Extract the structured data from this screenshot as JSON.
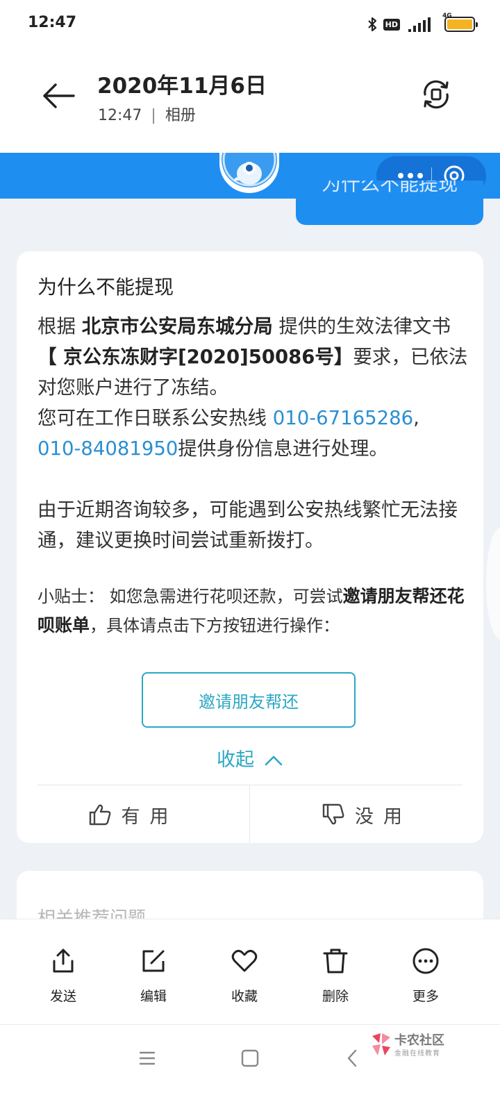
{
  "status_bar": {
    "time": "12:47",
    "hd_label": "HD",
    "network_label": "4G",
    "colors": {
      "battery": "#f5b324"
    },
    "icons": [
      "bluetooth-icon",
      "hd-icon",
      "signal-icon",
      "battery-icon"
    ]
  },
  "header": {
    "title": "2020年11月6日",
    "subtitle_time": "12:47",
    "subtitle_source": "相册",
    "icons": [
      "back-arrow-icon",
      "rotate-icon"
    ]
  },
  "chat": {
    "user_bubble_text": "为什么不能提现",
    "colors": {
      "accent_blue": "#1f8ef1",
      "link": "#2a8fd0",
      "button_teal": "#2ba7c4"
    }
  },
  "answer_card": {
    "title": "为什么不能提现",
    "p1_prefix": "根据 ",
    "p1_agency": "北京市公安局东城分局",
    "p1_middle": " 提供的生效法律文书",
    "p1_doc": "【 京公东冻财字[2020]50086号】",
    "p1_suffix": "要求，已依法对您账户进行了冻结。",
    "p2_prefix": "您可在工作日联系公安热线 ",
    "phone_1": "010-67165286",
    "p2_sep": ", ",
    "phone_2": "010-84081950",
    "p2_suffix": "提供身份信息进行处理。",
    "p3": "由于近期咨询较多，可能遇到公安热线繁忙无法接通，建议更换时间尝试重新拨打。",
    "tip_prefix": "小贴士： 如您急需进行花呗还款，可尝试",
    "tip_bold": "邀请朋友帮还花呗账单",
    "tip_suffix": "，具体请点击下方按钮进行操作：",
    "invite_button": "邀请朋友帮还",
    "collapse_label": "收起",
    "vote_yes": "有用",
    "vote_no": "没用"
  },
  "related": {
    "title": "相关推荐问题"
  },
  "toolbar": {
    "items": [
      {
        "label": "发送",
        "icon": "share-icon"
      },
      {
        "label": "编辑",
        "icon": "edit-icon"
      },
      {
        "label": "收藏",
        "icon": "heart-icon"
      },
      {
        "label": "删除",
        "icon": "trash-icon"
      },
      {
        "label": "更多",
        "icon": "more-icon"
      }
    ]
  },
  "nav": {
    "icons": [
      "menu-icon",
      "home-icon",
      "back-icon"
    ],
    "watermark_title": "卡农社区",
    "watermark_sub": "金融在线教育"
  }
}
